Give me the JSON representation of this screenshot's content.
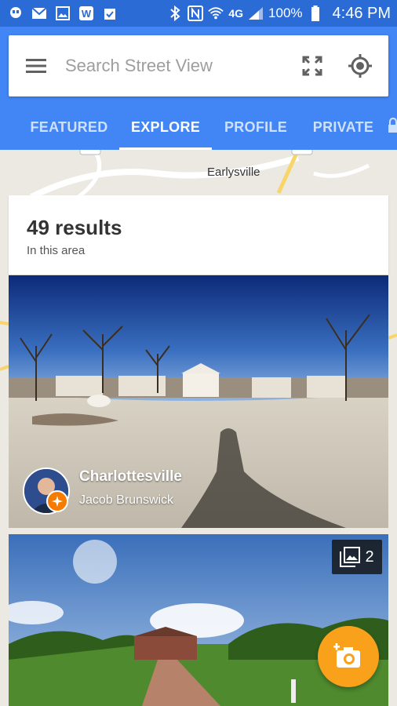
{
  "status_bar": {
    "battery": "100%",
    "time": "4:46 PM",
    "network": "4G"
  },
  "search": {
    "placeholder": "Search Street View"
  },
  "tabs": [
    {
      "label": "FEATURED"
    },
    {
      "label": "EXPLORE"
    },
    {
      "label": "PROFILE"
    },
    {
      "label": "PRIVATE"
    }
  ],
  "map": {
    "place_label": "Earlysville"
  },
  "results": {
    "count": "49 results",
    "subtitle": "In this area"
  },
  "cards": [
    {
      "place": "Charlottesville",
      "author": "Jacob Brunswick"
    },
    {
      "photo_count": "2"
    }
  ],
  "colors": {
    "header": "#4285f4",
    "status_bar": "#2a6bd6",
    "fab": "#f9a11b",
    "badge": "#f57c00"
  }
}
